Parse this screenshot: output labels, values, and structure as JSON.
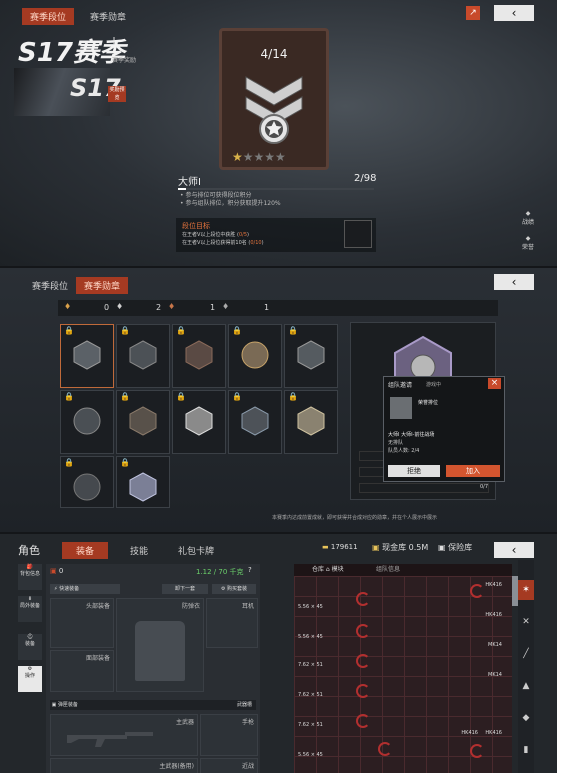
{
  "colors": {
    "accent": "#a53a22",
    "green": "#6bd16b",
    "orange": "#e4733d",
    "red": "#b22f2f"
  },
  "season": {
    "tabs": [
      "赛季段位",
      "赛季勋章"
    ],
    "title": "S17赛季",
    "side_label": "赛季奖励",
    "card_badge": "S17",
    "card_tag": "奖励预览",
    "progress": "4/14",
    "rank_name": "大师Ⅰ",
    "rank_stars": "2/98",
    "rules": [
      "参与排位可获得段位积分",
      "参与组队排位，积分获取提升120%"
    ],
    "goal_title": "段位目标",
    "goals": [
      {
        "text": "在王者Ⅴ以上段位中获胜",
        "progress": "0/5"
      },
      {
        "text": "在王者Ⅴ以上段位获得前10名",
        "progress": "0/10"
      }
    ],
    "side_buttons": [
      "战绩",
      "荣誉"
    ]
  },
  "medals": {
    "tabs": [
      "赛季段位",
      "赛季勋章"
    ],
    "counts": [
      "0",
      "2",
      "1",
      "1"
    ],
    "popup": {
      "title": "组队邀请",
      "subtitle": "游戏中",
      "name": "荣誉排位",
      "player": "大师Ⅰ 大师Ⅰ-前往战场",
      "mode": "无排队",
      "team": "队员人数: 2/4",
      "reject": "拒绝",
      "join": "加入"
    },
    "detail_progress": "0/7",
    "note": "本赛季内达成前置成就，即可获得并合成对应的勋章，并在个人展示中展示"
  },
  "loadout": {
    "title": "角色",
    "tabs": [
      "装备",
      "技能",
      "礼包卡牌"
    ],
    "coins": "179611",
    "warehouse": "现金库 0.5M",
    "insurance_label": "保险库",
    "left_nav": [
      "背包信息",
      "局外装备",
      "装备",
      "操作"
    ],
    "count": "0",
    "weight": "1.12 / 70 千克",
    "quick_equip": "快速装备",
    "unequip_all": "卸下一套",
    "quick_buy": "购买套装",
    "slots": [
      "头部装备",
      "防弹衣",
      "耳机",
      "面部装备"
    ],
    "weapons_header": "弹匣装备",
    "weapons_label": "武器槽",
    "primary": "主武器",
    "pistol": "手枪",
    "primary2": "主武器(备用)",
    "melee": "近战",
    "stash_tabs": [
      "仓库",
      "模块",
      "组队信息"
    ],
    "ammo": [
      {
        "caliber": "5.56 × 45",
        "gun": "HK416"
      },
      {
        "caliber": "5.56 × 45",
        "gun": "HK416"
      },
      {
        "caliber": "7.62 × 51",
        "gun": "MK14"
      },
      {
        "caliber": "7.62 × 51",
        "gun": "MK14"
      },
      {
        "caliber": "7.62 × 51",
        "gun": "HK416"
      },
      {
        "caliber": "5.56 × 45",
        "gun": "HK416"
      }
    ]
  }
}
